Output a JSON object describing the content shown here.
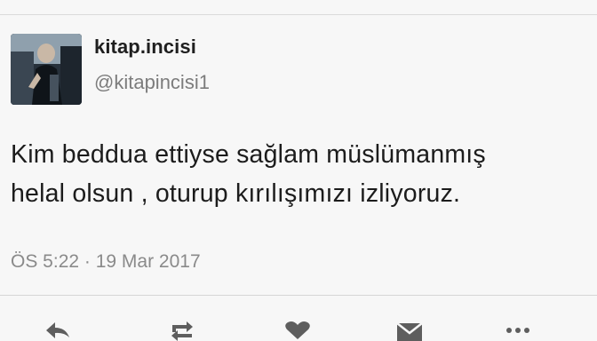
{
  "tweet": {
    "display_name": "kitap.incisi",
    "handle": "@kitapincisi1",
    "text_lines": [
      "Kim beddua ettiyse sağlam müslümanmış",
      "helal olsun , oturup kırılışımızı izliyoruz."
    ],
    "timestamp": "ÖS 5:22 · 19 Mar 2017"
  },
  "icons": {
    "avatar": "profile-photo",
    "actions": [
      "reply-icon",
      "retweet-icon",
      "like-icon",
      "direct-message-icon",
      "more-icon"
    ]
  },
  "colors": {
    "background": "#f7f7f7",
    "text": "#1c1c1c",
    "secondary_text": "#7c7c7c",
    "divider": "#d6d6d6",
    "action_icon": "#6b6b6b"
  }
}
